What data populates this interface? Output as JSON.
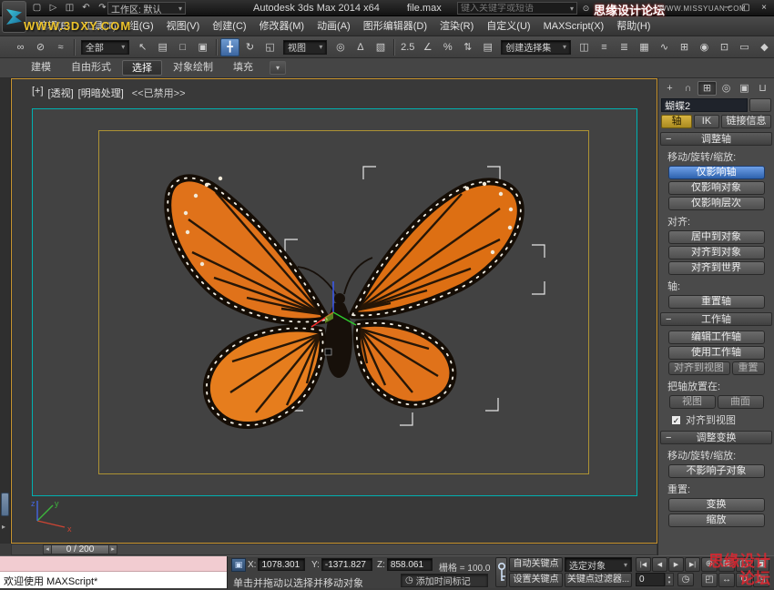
{
  "icons": {
    "caret_down": "▾",
    "caret_small": "▸",
    "minus": "−",
    "check": "✓",
    "clock": "◷",
    "lock": "▣",
    "ts_prev": "◂",
    "ts_next": "▸",
    "spin_up": "▴",
    "spin_down": "▾"
  },
  "titlebar": {
    "qat": [
      {
        "n": "new-scene-icon",
        "g": "▢"
      },
      {
        "n": "open-file-icon",
        "g": "▷"
      },
      {
        "n": "save-file-icon",
        "g": "◫"
      },
      {
        "n": "undo-icon",
        "g": "↶"
      },
      {
        "n": "redo-icon",
        "g": "↷"
      }
    ],
    "workspace_value": "工作区: 默认",
    "app_title": "Autodesk 3ds Max  2014 x64",
    "file_name": "file.max",
    "search_placeholder": "键入关键字或短语",
    "infocenter": [
      {
        "n": "search-icon",
        "g": "⊙"
      },
      {
        "n": "favorites-star-icon",
        "g": "★"
      },
      {
        "n": "help-icon",
        "g": "?"
      }
    ],
    "window_controls": [
      {
        "n": "minimize-button",
        "g": "─"
      },
      {
        "n": "maximize-button",
        "g": "▢"
      },
      {
        "n": "close-button",
        "g": "×"
      }
    ]
  },
  "menubar": {
    "items": [
      "编辑(E)",
      "工具(T)",
      "组(G)",
      "视图(V)",
      "创建(C)",
      "修改器(M)",
      "动画(A)",
      "图形编辑器(D)",
      "渲染(R)",
      "自定义(U)",
      "MAXScript(X)",
      "帮助(H)"
    ]
  },
  "toolbar": {
    "link_group": [
      {
        "n": "select-and-link-icon",
        "g": "∞"
      },
      {
        "n": "unlink-selection-icon",
        "g": "⊘"
      },
      {
        "n": "bind-to-spacewarp-icon",
        "g": "≈"
      }
    ],
    "filter_value": "全部",
    "select_group": [
      {
        "n": "select-object-icon",
        "g": "↖"
      },
      {
        "n": "select-by-name-icon",
        "g": "▤"
      },
      {
        "n": "selection-region-icon",
        "g": "□"
      },
      {
        "n": "window-crossing-icon",
        "g": "▣"
      }
    ],
    "transform_group": [
      {
        "n": "select-and-move-icon",
        "g": "╋",
        "active": true
      },
      {
        "n": "select-and-rotate-icon",
        "g": "↻"
      },
      {
        "n": "select-and-scale-icon",
        "g": "◱"
      }
    ],
    "coord_value": "视图",
    "pivot_group": [
      {
        "n": "use-pivot-center-icon",
        "g": "◎"
      },
      {
        "n": "select-and-manipulate-icon",
        "g": "∆"
      },
      {
        "n": "keyboard-override-icon",
        "g": "▧"
      }
    ],
    "snap_group": [
      {
        "n": "snap-toggle-icon",
        "g": "2.5"
      },
      {
        "n": "angle-snap-icon",
        "g": "∠"
      },
      {
        "n": "percent-snap-icon",
        "g": "%"
      },
      {
        "n": "spinner-snap-icon",
        "g": "⇅"
      },
      {
        "n": "edit-named-sets-icon",
        "g": "▤"
      }
    ],
    "sets_value": "创建选择集",
    "right_group": [
      {
        "n": "mirror-icon",
        "g": "◫"
      },
      {
        "n": "align-icon",
        "g": "≡"
      },
      {
        "n": "layer-manager-icon",
        "g": "≣"
      },
      {
        "n": "graphite-toggle-icon",
        "g": "▦"
      },
      {
        "n": "curve-editor-icon",
        "g": "∿"
      },
      {
        "n": "schematic-view-icon",
        "g": "⊞"
      },
      {
        "n": "material-editor-icon",
        "g": "◉"
      },
      {
        "n": "render-setup-icon",
        "g": "⊡"
      },
      {
        "n": "rendered-frame-icon",
        "g": "▭"
      },
      {
        "n": "render-production-icon",
        "g": "◆"
      }
    ]
  },
  "ribbon": {
    "tabs": [
      {
        "label": "建模"
      },
      {
        "label": "自由形式"
      },
      {
        "label": "选择",
        "active": true
      },
      {
        "label": "对象绘制"
      },
      {
        "label": "填充"
      }
    ]
  },
  "viewport": {
    "label_plus": "[+]",
    "label_view": "[透视]",
    "label_shading": "[明暗处理]",
    "label_disabled": "<<已禁用>>",
    "axis_x": "x",
    "axis_y": "y",
    "axis_z": "z"
  },
  "timeline": {
    "slider_label": "0 / 200"
  },
  "command_panel": {
    "object_name": "蝴蝶2",
    "tabs": [
      {
        "n": "create-tab",
        "g": "+"
      },
      {
        "n": "modify-tab",
        "g": "∩"
      },
      {
        "n": "hierarchy-tab",
        "g": "⊞",
        "active": true
      },
      {
        "n": "motion-tab",
        "g": "◎"
      },
      {
        "n": "display-tab",
        "g": "▣"
      },
      {
        "n": "utilities-tab",
        "g": "⊔"
      }
    ],
    "mode_tabs": {
      "pivot": "轴",
      "ik": "IK",
      "link_info": "链接信息"
    },
    "adjust_pivot": {
      "header": "调整轴",
      "move_label": "移动/旋转/缩放:",
      "affect_pivot_only": "仅影响轴",
      "affect_object_only": "仅影响对象",
      "affect_hierarchy_only": "仅影响层次",
      "align_label": "对齐:",
      "center_to_object": "居中到对象",
      "align_to_object": "对齐到对象",
      "align_to_world": "对齐到世界",
      "pivot_label": "轴:",
      "reset_pivot": "重置轴"
    },
    "working_pivot": {
      "header": "工作轴",
      "edit_working_pivot": "编辑工作轴",
      "use_working_pivot": "使用工作轴",
      "align_to_view": "对齐到视图",
      "reset": "重置",
      "place_label": "把轴放置在:",
      "view": "视图",
      "surface": "曲面",
      "align_view_checkbox": "对齐到视图"
    },
    "adjust_transform": {
      "header": "调整变换",
      "move_label": "移动/旋转/缩放:",
      "dont_affect_children": "不影响子对象",
      "reset_label": "重置:",
      "transform": "变换",
      "scale": "缩放"
    }
  },
  "statusbar": {
    "maxscript_text": "欢迎使用 MAXScript*",
    "prompt": "单击并拖动以选择并移动对象",
    "x_label": "X:",
    "x_value": "1078.301",
    "y_label": "Y:",
    "y_value": "-1371.827",
    "z_label": "Z:",
    "z_value": "858.061",
    "grid_label": "栅格 = 100.0",
    "time_tag": "添加时间标记",
    "auto_key": "自动关键点",
    "set_key": "设置关键点",
    "key_mode_value": "选定对象",
    "key_filters": "关键点过滤器...",
    "frame_value": "0",
    "playback": [
      {
        "n": "go-to-start-button",
        "g": "|◀"
      },
      {
        "n": "previous-frame-button",
        "g": "◀"
      },
      {
        "n": "play-button",
        "g": "▶"
      },
      {
        "n": "go-to-end-button",
        "g": "▶|"
      }
    ],
    "nav": [
      {
        "n": "zoom-icon",
        "g": "⊕"
      },
      {
        "n": "zoom-all-icon",
        "g": "⊞"
      },
      {
        "n": "zoom-extents-icon",
        "g": "▢"
      },
      {
        "n": "zoom-extents-all-icon",
        "g": "▣"
      },
      {
        "n": "zoom-region-icon",
        "g": "◰"
      },
      {
        "n": "pan-icon",
        "g": "↔"
      },
      {
        "n": "orbit-icon",
        "g": "↻"
      },
      {
        "n": "maximize-viewport-icon",
        "g": "◳"
      }
    ]
  },
  "watermarks": {
    "menu": "WWW.3DXY.COM",
    "site_name": "思缘设计论坛",
    "site_url": "WWW.MISSYUAN.COM",
    "bottom_right": "思缘设计论坛"
  }
}
